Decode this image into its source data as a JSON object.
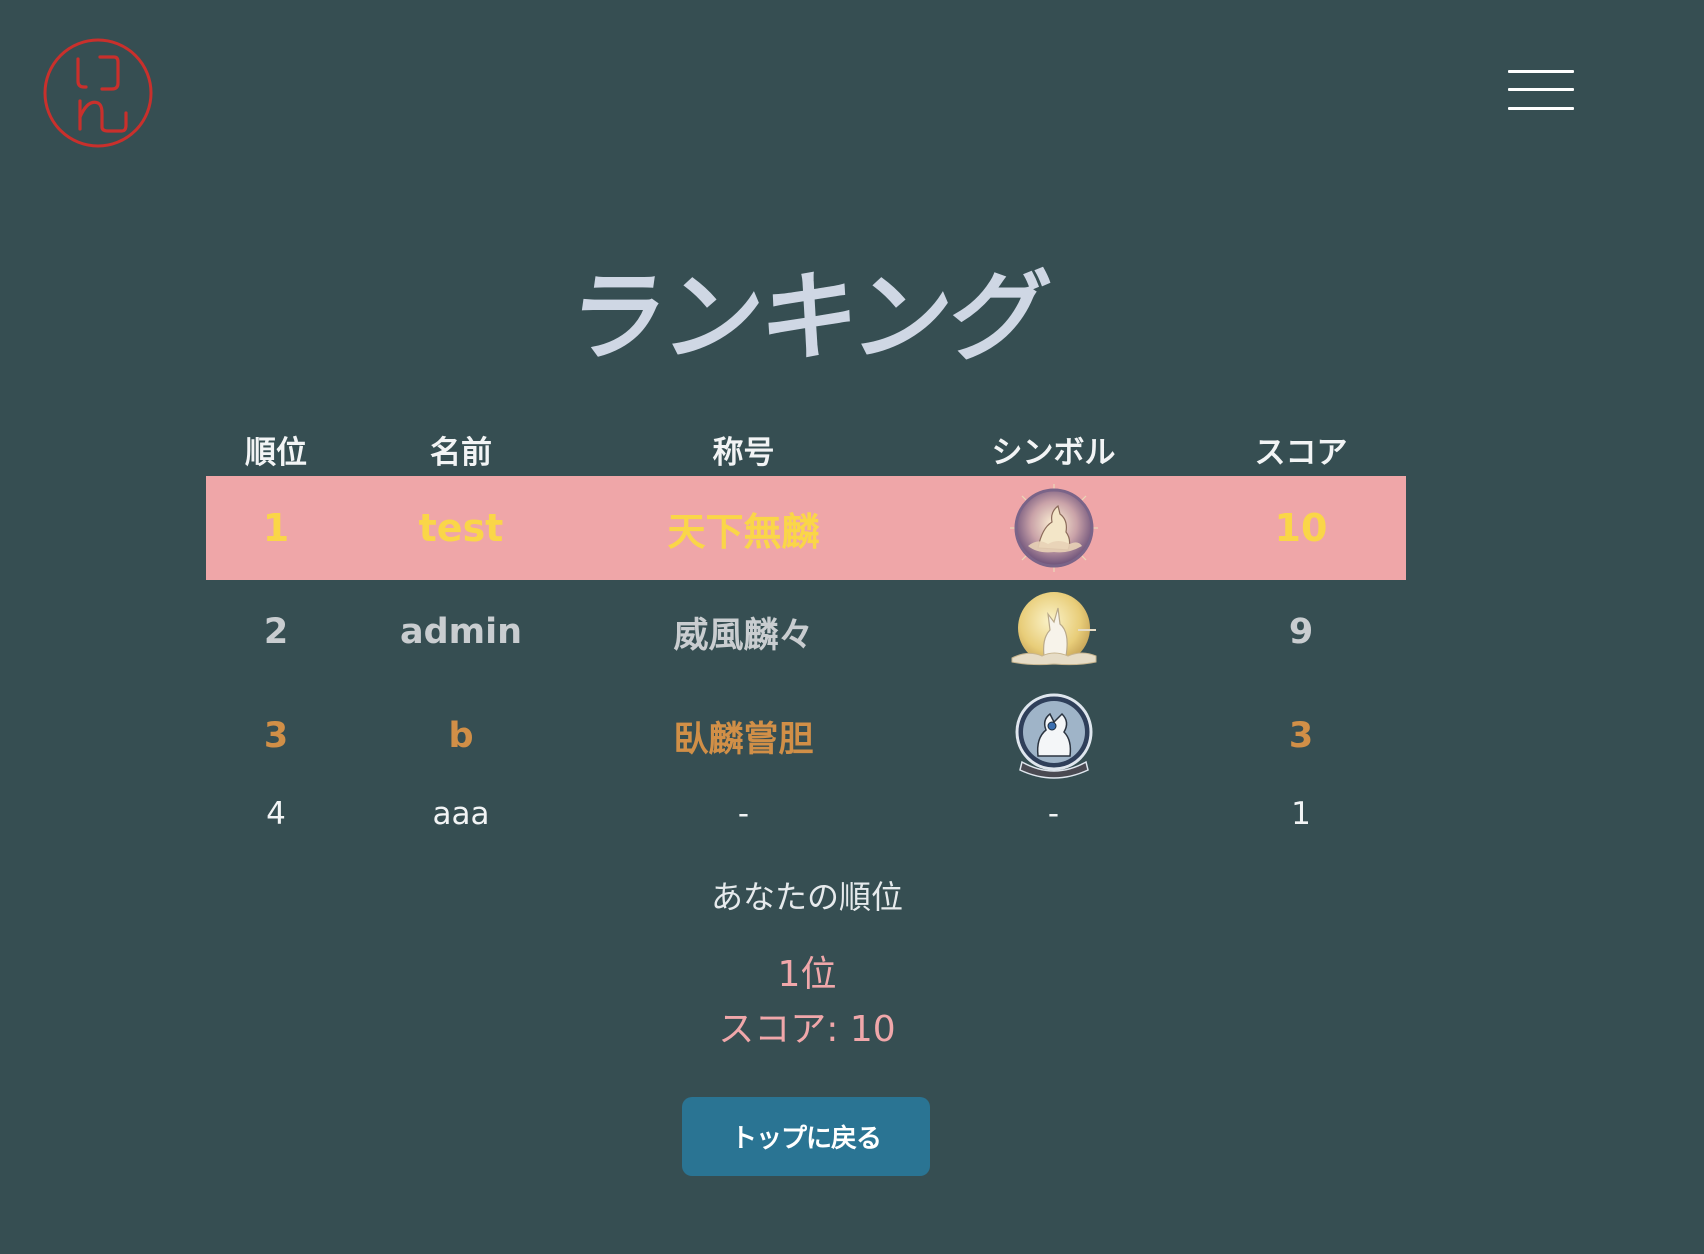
{
  "header": {
    "logo_icon": "rin-logo-icon",
    "logo_color": "#c9302c",
    "menu_icon": "hamburger-menu-icon"
  },
  "page": {
    "title": "ランキング"
  },
  "table": {
    "headers": {
      "rank": "順位",
      "name": "名前",
      "title": "称号",
      "symbol": "シンボル",
      "score": "スコア"
    },
    "rows": [
      {
        "rank": "1",
        "name": "test",
        "title": "天下無麟",
        "symbol": "kirin-gold-medallion-icon",
        "score": "10",
        "highlight_bg": "#efa6a8",
        "text_color": "#fad648"
      },
      {
        "rank": "2",
        "name": "admin",
        "title": "威風麟々",
        "symbol": "kirin-silver-moon-icon",
        "score": "9",
        "text_color": "#c9cdd0"
      },
      {
        "rank": "3",
        "name": "b",
        "title": "臥麟嘗胆",
        "symbol": "kirin-bronze-emblem-icon",
        "score": "3",
        "text_color": "#d18f47"
      },
      {
        "rank": "4",
        "name": "aaa",
        "title": "-",
        "symbol": "-",
        "score": "1",
        "text_color": "#f2f4f5"
      }
    ]
  },
  "your_rank": {
    "label": "あなたの順位",
    "rank_text": "1位",
    "score_text": "スコア: 10"
  },
  "actions": {
    "back_label": "トップに戻る"
  },
  "colors": {
    "background": "#364e52",
    "accent_pink": "#f0a7aa",
    "button": "#2a7493"
  }
}
